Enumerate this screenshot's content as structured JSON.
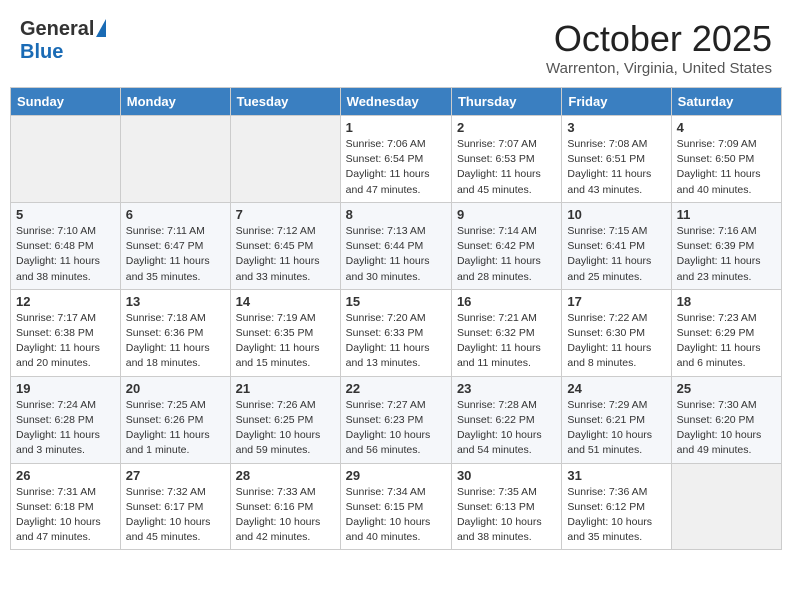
{
  "header": {
    "logo_general": "General",
    "logo_blue": "Blue",
    "month": "October 2025",
    "location": "Warrenton, Virginia, United States"
  },
  "weekdays": [
    "Sunday",
    "Monday",
    "Tuesday",
    "Wednesday",
    "Thursday",
    "Friday",
    "Saturday"
  ],
  "weeks": [
    [
      {
        "day": "",
        "info": ""
      },
      {
        "day": "",
        "info": ""
      },
      {
        "day": "",
        "info": ""
      },
      {
        "day": "1",
        "info": "Sunrise: 7:06 AM\nSunset: 6:54 PM\nDaylight: 11 hours\nand 47 minutes."
      },
      {
        "day": "2",
        "info": "Sunrise: 7:07 AM\nSunset: 6:53 PM\nDaylight: 11 hours\nand 45 minutes."
      },
      {
        "day": "3",
        "info": "Sunrise: 7:08 AM\nSunset: 6:51 PM\nDaylight: 11 hours\nand 43 minutes."
      },
      {
        "day": "4",
        "info": "Sunrise: 7:09 AM\nSunset: 6:50 PM\nDaylight: 11 hours\nand 40 minutes."
      }
    ],
    [
      {
        "day": "5",
        "info": "Sunrise: 7:10 AM\nSunset: 6:48 PM\nDaylight: 11 hours\nand 38 minutes."
      },
      {
        "day": "6",
        "info": "Sunrise: 7:11 AM\nSunset: 6:47 PM\nDaylight: 11 hours\nand 35 minutes."
      },
      {
        "day": "7",
        "info": "Sunrise: 7:12 AM\nSunset: 6:45 PM\nDaylight: 11 hours\nand 33 minutes."
      },
      {
        "day": "8",
        "info": "Sunrise: 7:13 AM\nSunset: 6:44 PM\nDaylight: 11 hours\nand 30 minutes."
      },
      {
        "day": "9",
        "info": "Sunrise: 7:14 AM\nSunset: 6:42 PM\nDaylight: 11 hours\nand 28 minutes."
      },
      {
        "day": "10",
        "info": "Sunrise: 7:15 AM\nSunset: 6:41 PM\nDaylight: 11 hours\nand 25 minutes."
      },
      {
        "day": "11",
        "info": "Sunrise: 7:16 AM\nSunset: 6:39 PM\nDaylight: 11 hours\nand 23 minutes."
      }
    ],
    [
      {
        "day": "12",
        "info": "Sunrise: 7:17 AM\nSunset: 6:38 PM\nDaylight: 11 hours\nand 20 minutes."
      },
      {
        "day": "13",
        "info": "Sunrise: 7:18 AM\nSunset: 6:36 PM\nDaylight: 11 hours\nand 18 minutes."
      },
      {
        "day": "14",
        "info": "Sunrise: 7:19 AM\nSunset: 6:35 PM\nDaylight: 11 hours\nand 15 minutes."
      },
      {
        "day": "15",
        "info": "Sunrise: 7:20 AM\nSunset: 6:33 PM\nDaylight: 11 hours\nand 13 minutes."
      },
      {
        "day": "16",
        "info": "Sunrise: 7:21 AM\nSunset: 6:32 PM\nDaylight: 11 hours\nand 11 minutes."
      },
      {
        "day": "17",
        "info": "Sunrise: 7:22 AM\nSunset: 6:30 PM\nDaylight: 11 hours\nand 8 minutes."
      },
      {
        "day": "18",
        "info": "Sunrise: 7:23 AM\nSunset: 6:29 PM\nDaylight: 11 hours\nand 6 minutes."
      }
    ],
    [
      {
        "day": "19",
        "info": "Sunrise: 7:24 AM\nSunset: 6:28 PM\nDaylight: 11 hours\nand 3 minutes."
      },
      {
        "day": "20",
        "info": "Sunrise: 7:25 AM\nSunset: 6:26 PM\nDaylight: 11 hours\nand 1 minute."
      },
      {
        "day": "21",
        "info": "Sunrise: 7:26 AM\nSunset: 6:25 PM\nDaylight: 10 hours\nand 59 minutes."
      },
      {
        "day": "22",
        "info": "Sunrise: 7:27 AM\nSunset: 6:23 PM\nDaylight: 10 hours\nand 56 minutes."
      },
      {
        "day": "23",
        "info": "Sunrise: 7:28 AM\nSunset: 6:22 PM\nDaylight: 10 hours\nand 54 minutes."
      },
      {
        "day": "24",
        "info": "Sunrise: 7:29 AM\nSunset: 6:21 PM\nDaylight: 10 hours\nand 51 minutes."
      },
      {
        "day": "25",
        "info": "Sunrise: 7:30 AM\nSunset: 6:20 PM\nDaylight: 10 hours\nand 49 minutes."
      }
    ],
    [
      {
        "day": "26",
        "info": "Sunrise: 7:31 AM\nSunset: 6:18 PM\nDaylight: 10 hours\nand 47 minutes."
      },
      {
        "day": "27",
        "info": "Sunrise: 7:32 AM\nSunset: 6:17 PM\nDaylight: 10 hours\nand 45 minutes."
      },
      {
        "day": "28",
        "info": "Sunrise: 7:33 AM\nSunset: 6:16 PM\nDaylight: 10 hours\nand 42 minutes."
      },
      {
        "day": "29",
        "info": "Sunrise: 7:34 AM\nSunset: 6:15 PM\nDaylight: 10 hours\nand 40 minutes."
      },
      {
        "day": "30",
        "info": "Sunrise: 7:35 AM\nSunset: 6:13 PM\nDaylight: 10 hours\nand 38 minutes."
      },
      {
        "day": "31",
        "info": "Sunrise: 7:36 AM\nSunset: 6:12 PM\nDaylight: 10 hours\nand 35 minutes."
      },
      {
        "day": "",
        "info": ""
      }
    ]
  ]
}
